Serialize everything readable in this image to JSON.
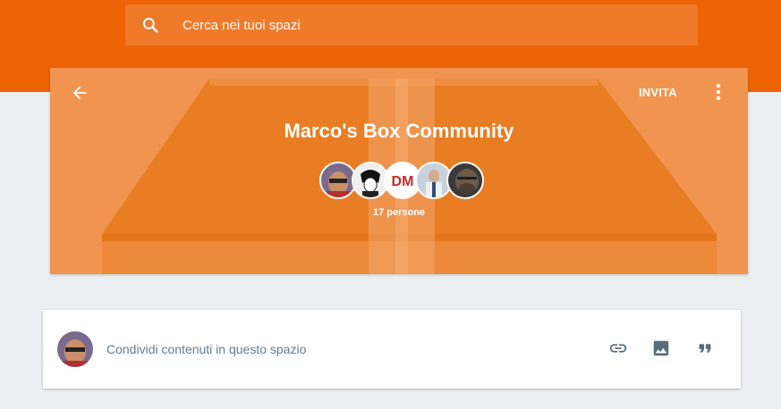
{
  "search": {
    "placeholder": "Cerca nei tuoi spazi",
    "icon": "search-icon"
  },
  "header": {
    "back_icon": "arrow-back-icon",
    "invite_label": "INVITA",
    "more_icon": "more-vert-icon",
    "title": "Marco's Box Community",
    "member_count": "17 persone",
    "member_avatars": [
      "avatar-1",
      "avatar-2",
      "avatar-dm",
      "avatar-4",
      "avatar-5"
    ],
    "dm_logo_text": "DM"
  },
  "composer": {
    "prompt": "Condividi contenuti in questo spazio",
    "actions": [
      "link-icon",
      "image-icon",
      "quote-icon"
    ]
  },
  "colors": {
    "brand": "#ec6406",
    "hero": "#f0944f",
    "muted_text": "#607d8b",
    "background": "#eceff1"
  }
}
